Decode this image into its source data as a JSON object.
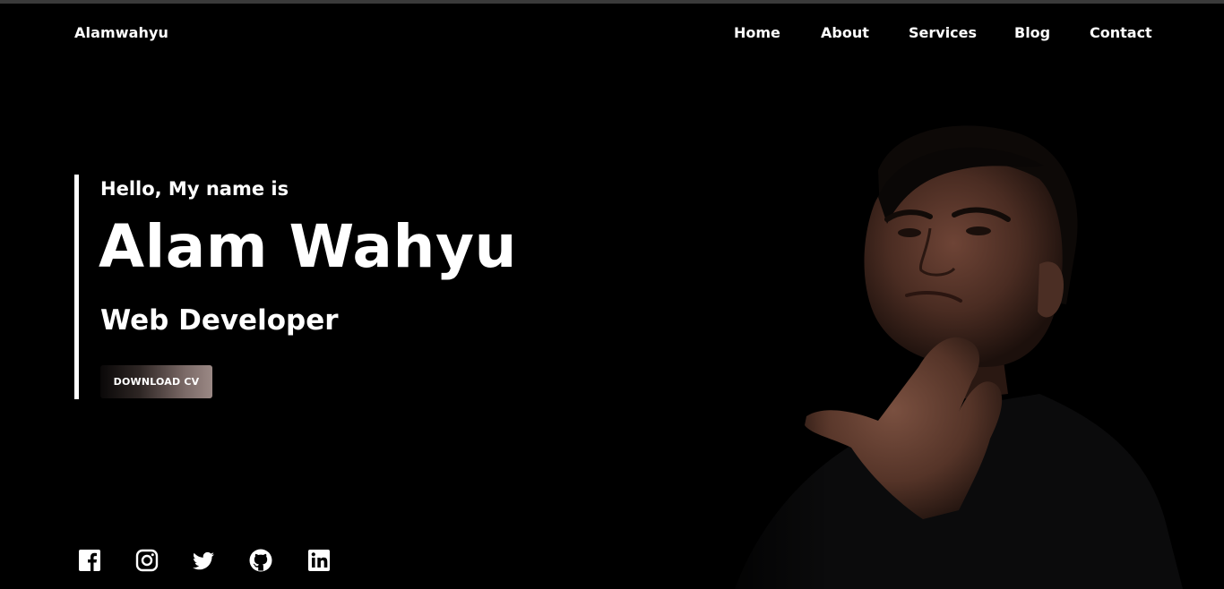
{
  "header": {
    "brand": "Alamwahyu",
    "nav": {
      "home": "Home",
      "about": "About",
      "services": "Services",
      "blog": "Blog",
      "contact": "Contact"
    }
  },
  "hero": {
    "greeting": "Hello, My name is",
    "name": "Alam Wahyu",
    "role": "Web Developer",
    "cta_label": "DOWNLOAD CV"
  },
  "social": {
    "icons": [
      "facebook-icon",
      "instagram-icon",
      "twitter-icon",
      "github-icon",
      "linkedin-icon"
    ]
  },
  "colors": {
    "background": "#000000",
    "text": "#ffffff",
    "button_gradient_start": "#0a0808",
    "button_gradient_end": "#9b8985"
  }
}
